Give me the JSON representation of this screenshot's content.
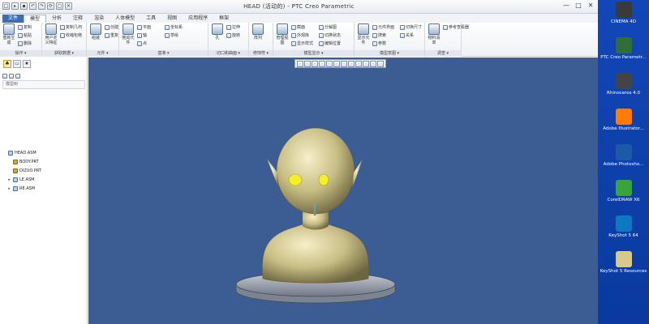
{
  "window": {
    "title": "HEAD (活动的) - PTC Creo Parametric",
    "min_glyph": "—",
    "max_glyph": "□",
    "close_glyph": "✕"
  },
  "quick_access": [
    "new-icon",
    "open-icon",
    "save-icon",
    "undo-icon",
    "redo-icon",
    "regenerate-icon",
    "window-icon",
    "close-window-icon"
  ],
  "menu": {
    "file": "文件",
    "tabs": [
      "模型",
      "分析",
      "注释",
      "渲染",
      "人体模型",
      "工具",
      "视图",
      "应用程序",
      "框架"
    ],
    "active": "模型"
  },
  "ribbon": {
    "groups": [
      {
        "label": "操作 ▾",
        "items": [
          "重新生成",
          "复制",
          "粘贴",
          "删除"
        ]
      },
      {
        "label": "获取数据 ▾",
        "items": [
          "用户定义特征",
          "复制几何",
          "收缩包络"
        ]
      },
      {
        "label": "元件 ▾",
        "items": [
          "组装",
          "创建",
          "重复"
        ]
      },
      {
        "label": "基准 ▾",
        "items": [
          "拖动元件",
          "平面",
          "轴",
          "点",
          "坐标系",
          "草绘"
        ]
      },
      {
        "label": "切口和曲面 ▾",
        "items": [
          "孔",
          "拉伸",
          "旋转"
        ]
      },
      {
        "label": "修饰符 ▾",
        "items": [
          "阵列"
        ]
      },
      {
        "label": "模型显示 ▾",
        "items": [
          "管理视图",
          "截面",
          "外观库",
          "显示样式",
          "分解图",
          "切换状态",
          "编辑位置"
        ]
      },
      {
        "label": "模型意图 ▾",
        "items": [
          "显示元件",
          "元件界面",
          "搜索",
          "参数",
          "切换尺寸",
          "关系"
        ]
      },
      {
        "label": "调查 ▾",
        "items": [
          "物料清单",
          "参考查看器"
        ]
      }
    ]
  },
  "sidebar": {
    "header_title": "模型树",
    "tree": [
      {
        "label": "HEAD.ASM",
        "type": "asm",
        "indent": 0,
        "expander": ""
      },
      {
        "label": "BODY.PRT",
        "type": "prt",
        "indent": 1,
        "expander": ""
      },
      {
        "label": "DIZUO.PRT",
        "type": "prt",
        "indent": 1,
        "expander": ""
      },
      {
        "label": "LE.ASM",
        "type": "asm",
        "indent": 1,
        "expander": "▸"
      },
      {
        "label": "RE.ASM",
        "type": "asm",
        "indent": 1,
        "expander": "▸"
      }
    ]
  },
  "desktop_icons": [
    {
      "label": "CINEMA 4D",
      "color": "#3a3a3a"
    },
    {
      "label": "PTC Creo Parametr...",
      "color": "#2f6d3b"
    },
    {
      "label": "Rhinoceros 4.0",
      "color": "#444444"
    },
    {
      "label": "Adobe Illustrator...",
      "color": "#ff7c00"
    },
    {
      "label": "Adobe Photosho...",
      "color": "#1b5aa6"
    },
    {
      "label": "CorelDRAW X6",
      "color": "#39a33d"
    },
    {
      "label": "KeyShot 5 64",
      "color": "#0b79c4"
    },
    {
      "label": "KeyShot 5 Resources",
      "color": "#d8c98a"
    }
  ]
}
